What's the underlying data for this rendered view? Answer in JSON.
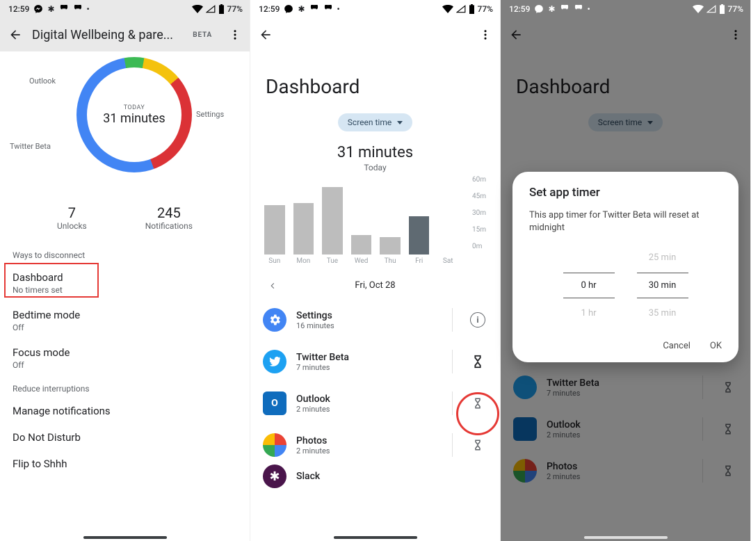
{
  "status": {
    "time": "12:59",
    "battery": "77%"
  },
  "pane1": {
    "title": "Digital Wellbeing & pare...",
    "beta": "BETA",
    "donut": {
      "label": "TODAY",
      "value": "31 minutes",
      "outlook": "Outlook",
      "settings": "Settings",
      "twitter": "Twitter Beta"
    },
    "unlocks": {
      "n": "7",
      "l": "Unlocks"
    },
    "notifications": {
      "n": "245",
      "l": "Notifications"
    },
    "section1": "Ways to disconnect",
    "dashboard": {
      "t": "Dashboard",
      "s": "No timers set"
    },
    "bedtime": {
      "t": "Bedtime mode",
      "s": "Off"
    },
    "focus": {
      "t": "Focus mode",
      "s": "Off"
    },
    "section2": "Reduce interruptions",
    "manage": "Manage notifications",
    "dnd": "Do Not Disturb",
    "flip": "Flip to Shhh"
  },
  "pane2": {
    "title": "Dashboard",
    "chip": "Screen time",
    "total": "31 minutes",
    "totalSub": "Today",
    "date": "Fri, Oct 28",
    "days": [
      "Sun",
      "Mon",
      "Tue",
      "Wed",
      "Thu",
      "Fri",
      "Sat"
    ],
    "ylabels": [
      "60m",
      "45m",
      "30m",
      "15m",
      "0m"
    ],
    "apps": {
      "settings": {
        "name": "Settings",
        "sub": "16 minutes"
      },
      "twitter": {
        "name": "Twitter Beta",
        "sub": "7 minutes"
      },
      "outlook": {
        "name": "Outlook",
        "sub": "2 minutes"
      },
      "photos": {
        "name": "Photos",
        "sub": "2 minutes"
      },
      "slack": {
        "name": "Slack",
        "sub": ""
      }
    }
  },
  "pane3": {
    "dialog_title": "Set app timer",
    "dialog_msg": "This app timer for Twitter Beta will reset at midnight",
    "hr_prev": "",
    "hr_sel": "0 hr",
    "hr_next": "1 hr",
    "min_prev": "25 min",
    "min_sel": "30 min",
    "min_next": "35 min",
    "cancel": "Cancel",
    "ok": "OK"
  },
  "chart_data": {
    "type": "bar",
    "categories": [
      "Sun",
      "Mon",
      "Tue",
      "Wed",
      "Thu",
      "Fri",
      "Sat"
    ],
    "values": [
      40,
      42,
      55,
      16,
      14,
      31,
      0
    ],
    "title": "Screen time",
    "xlabel": "",
    "ylabel": "minutes",
    "ylim": [
      0,
      60
    ],
    "highlight_index": 5
  }
}
